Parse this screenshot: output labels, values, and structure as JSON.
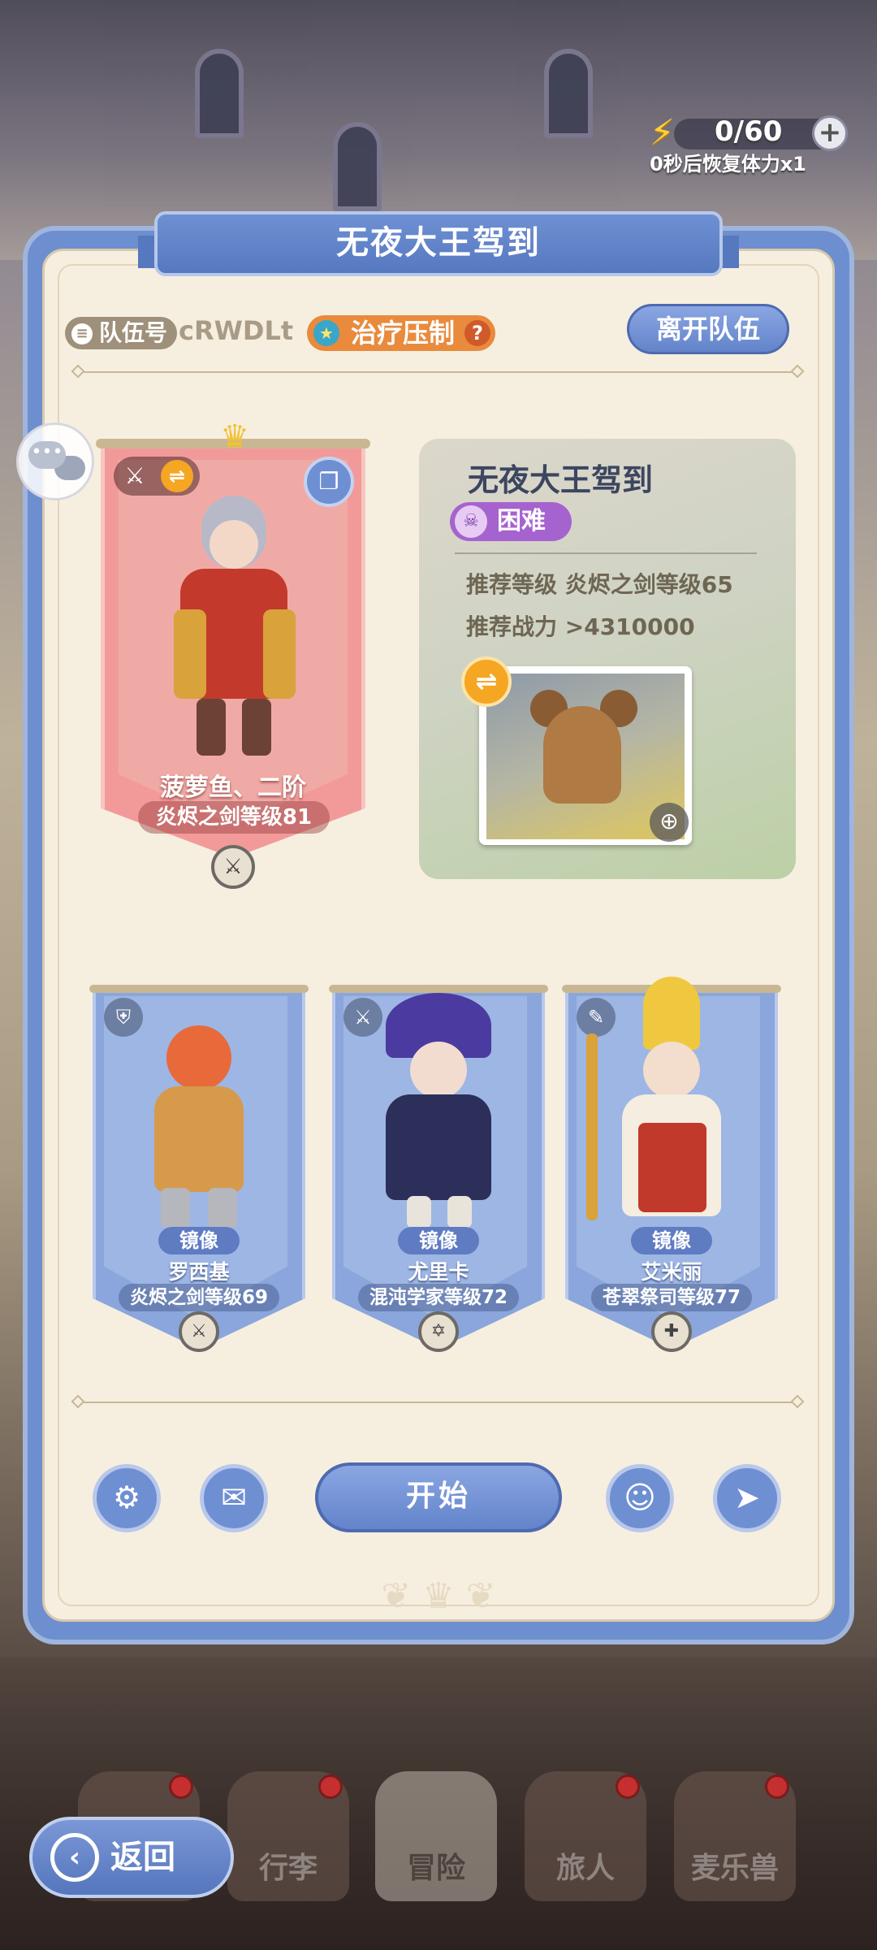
{
  "stamina": {
    "value": "0/60",
    "plus": "+",
    "recover_note": "0秒后恢复体力x1"
  },
  "panel": {
    "title": "无夜大王驾到",
    "team_label": "队伍号",
    "team_code": "cRWDLt",
    "heal_tag": "治疗压制",
    "help_mark": "?",
    "leave_button": "离开队伍",
    "start_button": "开始"
  },
  "leader": {
    "name": "菠萝鱼、二阶",
    "level": "炎烬之剑等级81"
  },
  "dungeon": {
    "name": "无夜大王驾到",
    "difficulty": "困难",
    "recommended_level": "推荐等级 炎烬之剑等级65",
    "recommended_power": "推荐战力 >4310000"
  },
  "members": [
    {
      "tag": "镜像",
      "name": "罗西基",
      "level": "炎烬之剑等级69"
    },
    {
      "tag": "镜像",
      "name": "尤里卡",
      "level": "混沌学家等级72"
    },
    {
      "tag": "镜像",
      "name": "艾米丽",
      "level": "苍翠祭司等级77"
    }
  ],
  "bottom_nav": [
    {
      "label": ""
    },
    {
      "label": "行李"
    },
    {
      "label": "冒险"
    },
    {
      "label": "旅人"
    },
    {
      "label": "麦乐兽"
    }
  ],
  "back_button": "返回",
  "colors": {
    "panel_blue": "#6d8fcf",
    "leader_banner": "#f29a9a",
    "member_banner": "#8aa6dc",
    "difficulty_purple": "#a563cf",
    "heal_orange": "#e98a3c"
  }
}
